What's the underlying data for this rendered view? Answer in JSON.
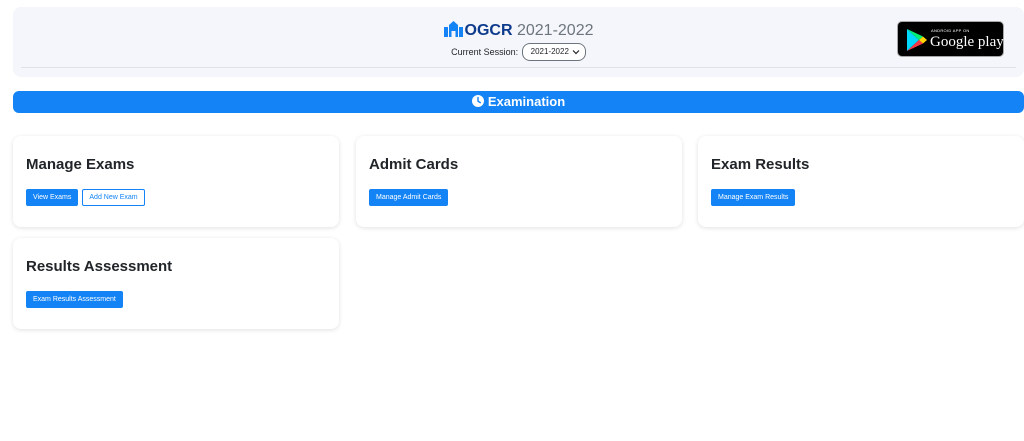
{
  "header": {
    "app_name": "OGCR",
    "year": "2021-2022",
    "session_label": "Current Session:",
    "session_value": "2021-2022",
    "store_badge": {
      "small_text": "ANDROID APP ON",
      "big_text": "Google play"
    }
  },
  "section": {
    "title": "Examination"
  },
  "cards": [
    {
      "title": "Manage Exams",
      "buttons": [
        "View Exams",
        "Add New Exam"
      ]
    },
    {
      "title": "Admit Cards",
      "buttons": [
        "Manage Admit Cards"
      ]
    },
    {
      "title": "Exam Results",
      "buttons": [
        "Manage Exam Results"
      ]
    },
    {
      "title": "Results Assessment",
      "buttons": [
        "Exam Results Assessment"
      ]
    }
  ],
  "colors": {
    "primary": "#1383f6",
    "brand": "#0d3b8c",
    "header_bg": "#f5f6fb"
  }
}
